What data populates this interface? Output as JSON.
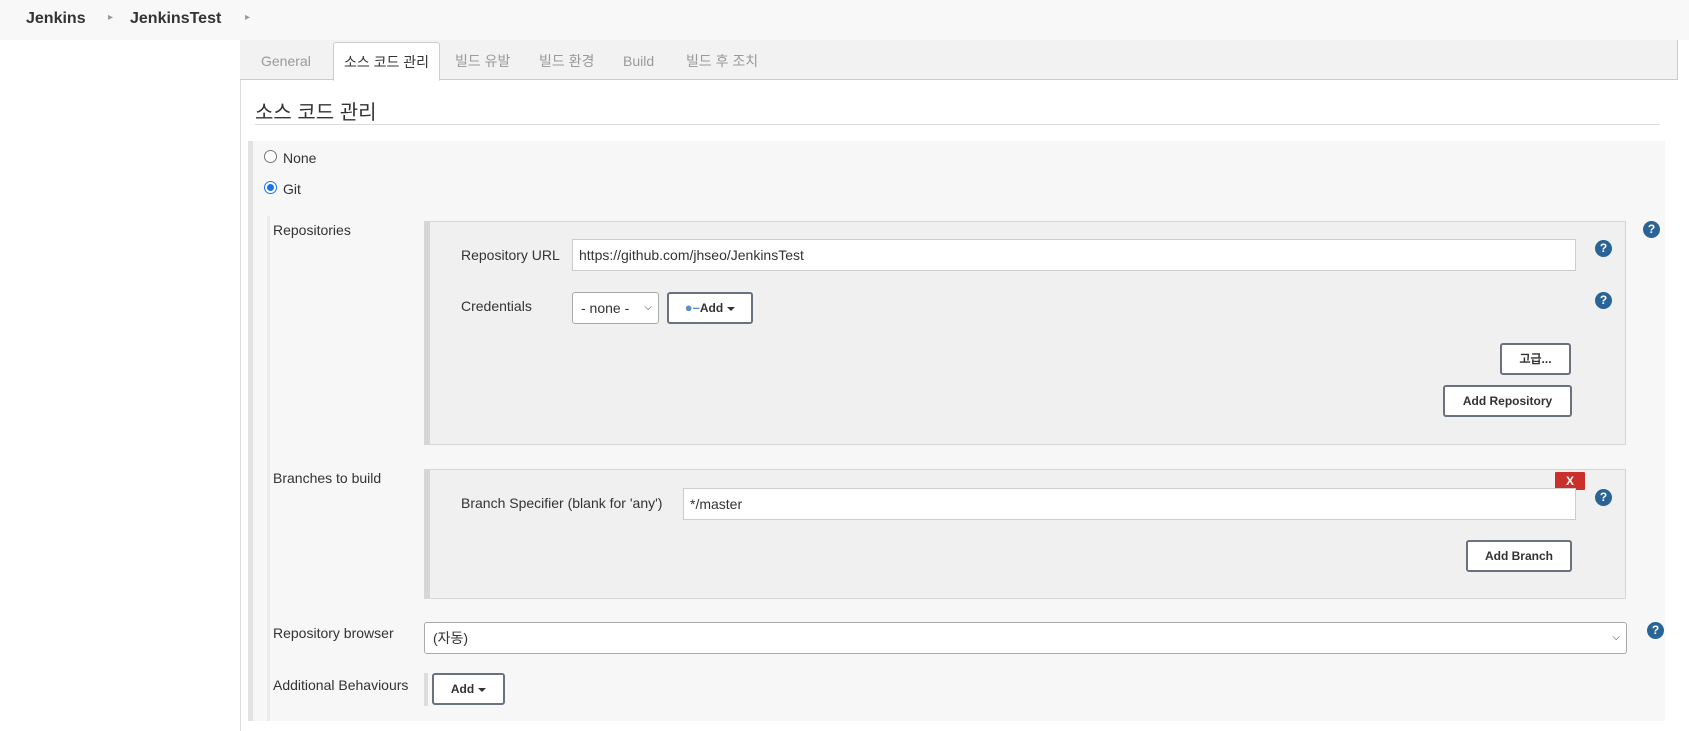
{
  "breadcrumb": {
    "items": [
      "Jenkins",
      "JenkinsTest"
    ]
  },
  "tabs": [
    {
      "label": "General",
      "active": false
    },
    {
      "label": "소스 코드 관리",
      "active": true
    },
    {
      "label": "빌드 유발",
      "active": false
    },
    {
      "label": "빌드 환경",
      "active": false
    },
    {
      "label": "Build",
      "active": false
    },
    {
      "label": "빌드 후 조치",
      "active": false
    }
  ],
  "section": {
    "title": "소스 코드 관리"
  },
  "scm": {
    "options": [
      {
        "label": "None",
        "selected": false
      },
      {
        "label": "Git",
        "selected": true
      }
    ]
  },
  "repositories": {
    "label": "Repositories",
    "url_label": "Repository URL",
    "url_value": "https://github.com/jhseo/JenkinsTest",
    "credentials_label": "Credentials",
    "credentials_value": "- none -",
    "add_label": "Add",
    "advanced_label": "고급...",
    "add_repository_label": "Add Repository"
  },
  "branches": {
    "label": "Branches to build",
    "specifier_label": "Branch Specifier (blank for 'any')",
    "specifier_value": "*/master",
    "remove_label": "X",
    "add_branch_label": "Add Branch"
  },
  "repository_browser": {
    "label": "Repository browser",
    "value": "(자동)"
  },
  "additional_behaviours": {
    "label": "Additional Behaviours",
    "add_label": "Add"
  },
  "help_glyph": "?",
  "colors": {
    "help": "#2a6496",
    "remove": "#c9302c",
    "radio_selected": "#1a73e8"
  }
}
